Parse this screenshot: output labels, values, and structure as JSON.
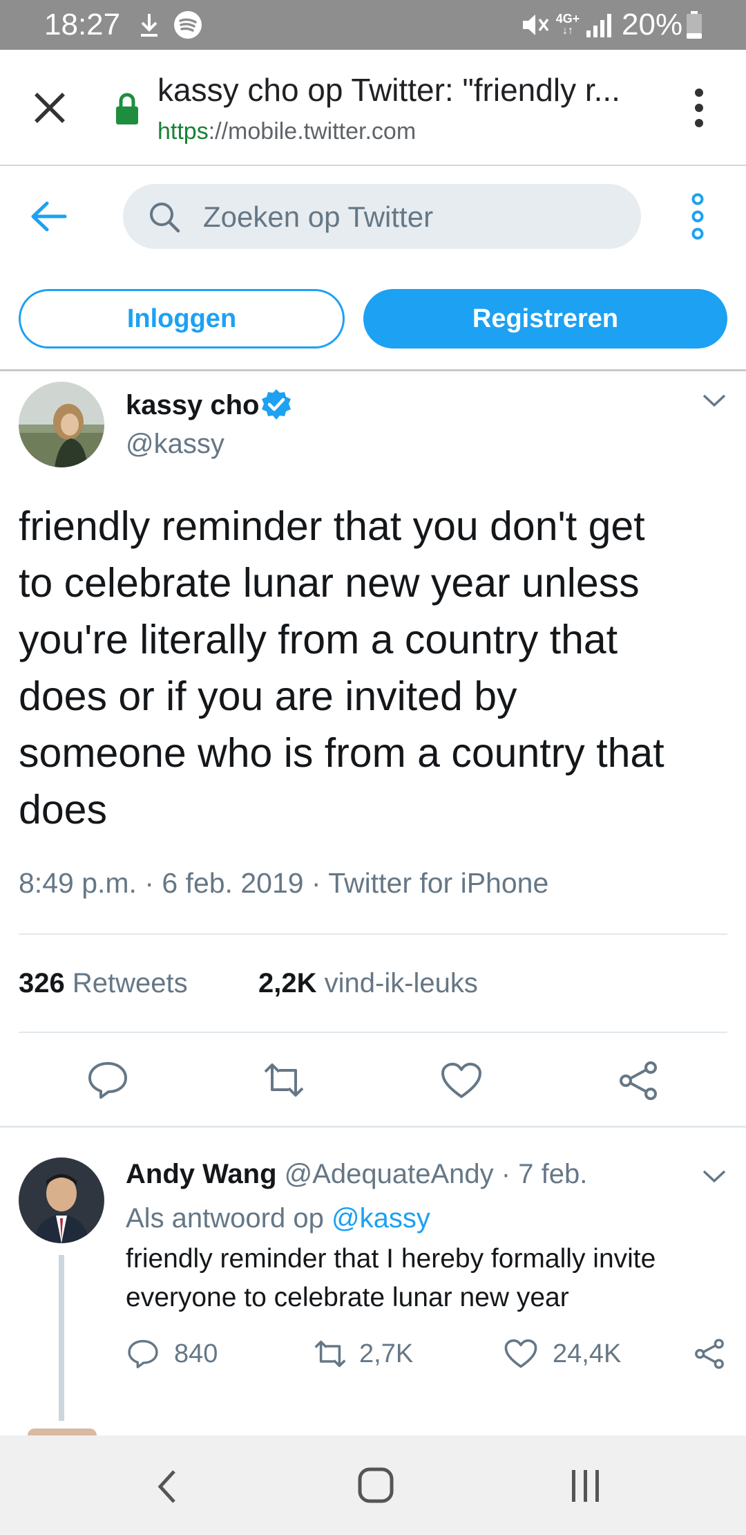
{
  "status_bar": {
    "time": "18:27",
    "battery": "20%",
    "network": "4G+",
    "icons": [
      "download-icon",
      "spotify-icon",
      "mute-icon",
      "signal-icon",
      "battery-icon"
    ]
  },
  "browser": {
    "page_title": "kassy cho op Twitter: \"friendly r...",
    "url_scheme": "https",
    "url_rest": "://mobile.twitter.com",
    "lock_color": "#1e8e3e"
  },
  "twitter_header": {
    "search_placeholder": "Zoeken op Twitter",
    "login_label": "Inloggen",
    "register_label": "Registreren",
    "accent_color": "#1da1f2"
  },
  "tweet": {
    "author_name": "kassy cho",
    "author_handle": "@kassy",
    "verified": true,
    "text_lines": [
      "friendly reminder that you don't get",
      "to celebrate lunar new year unless",
      "you're literally from a country that",
      "does or if you are invited by",
      "someone who is from a country that",
      "does"
    ],
    "meta": "8:49 p.m. · 6 feb. 2019 · Twitter for iPhone",
    "retweets_count": "326",
    "retweets_label": "Retweets",
    "likes_count": "2,2K",
    "likes_label": "vind-ik-leuks"
  },
  "reply": {
    "author_name": "Andy Wang",
    "author_handle": "@AdequateAndy",
    "date": "· 7 feb.",
    "replying_prefix": "Als antwoord op",
    "replying_to": "@kassy",
    "text_lines": [
      "friendly reminder that I hereby formally invite",
      "everyone to celebrate lunar new year"
    ],
    "replies": "840",
    "retweets": "2,7K",
    "likes": "24,4K"
  }
}
